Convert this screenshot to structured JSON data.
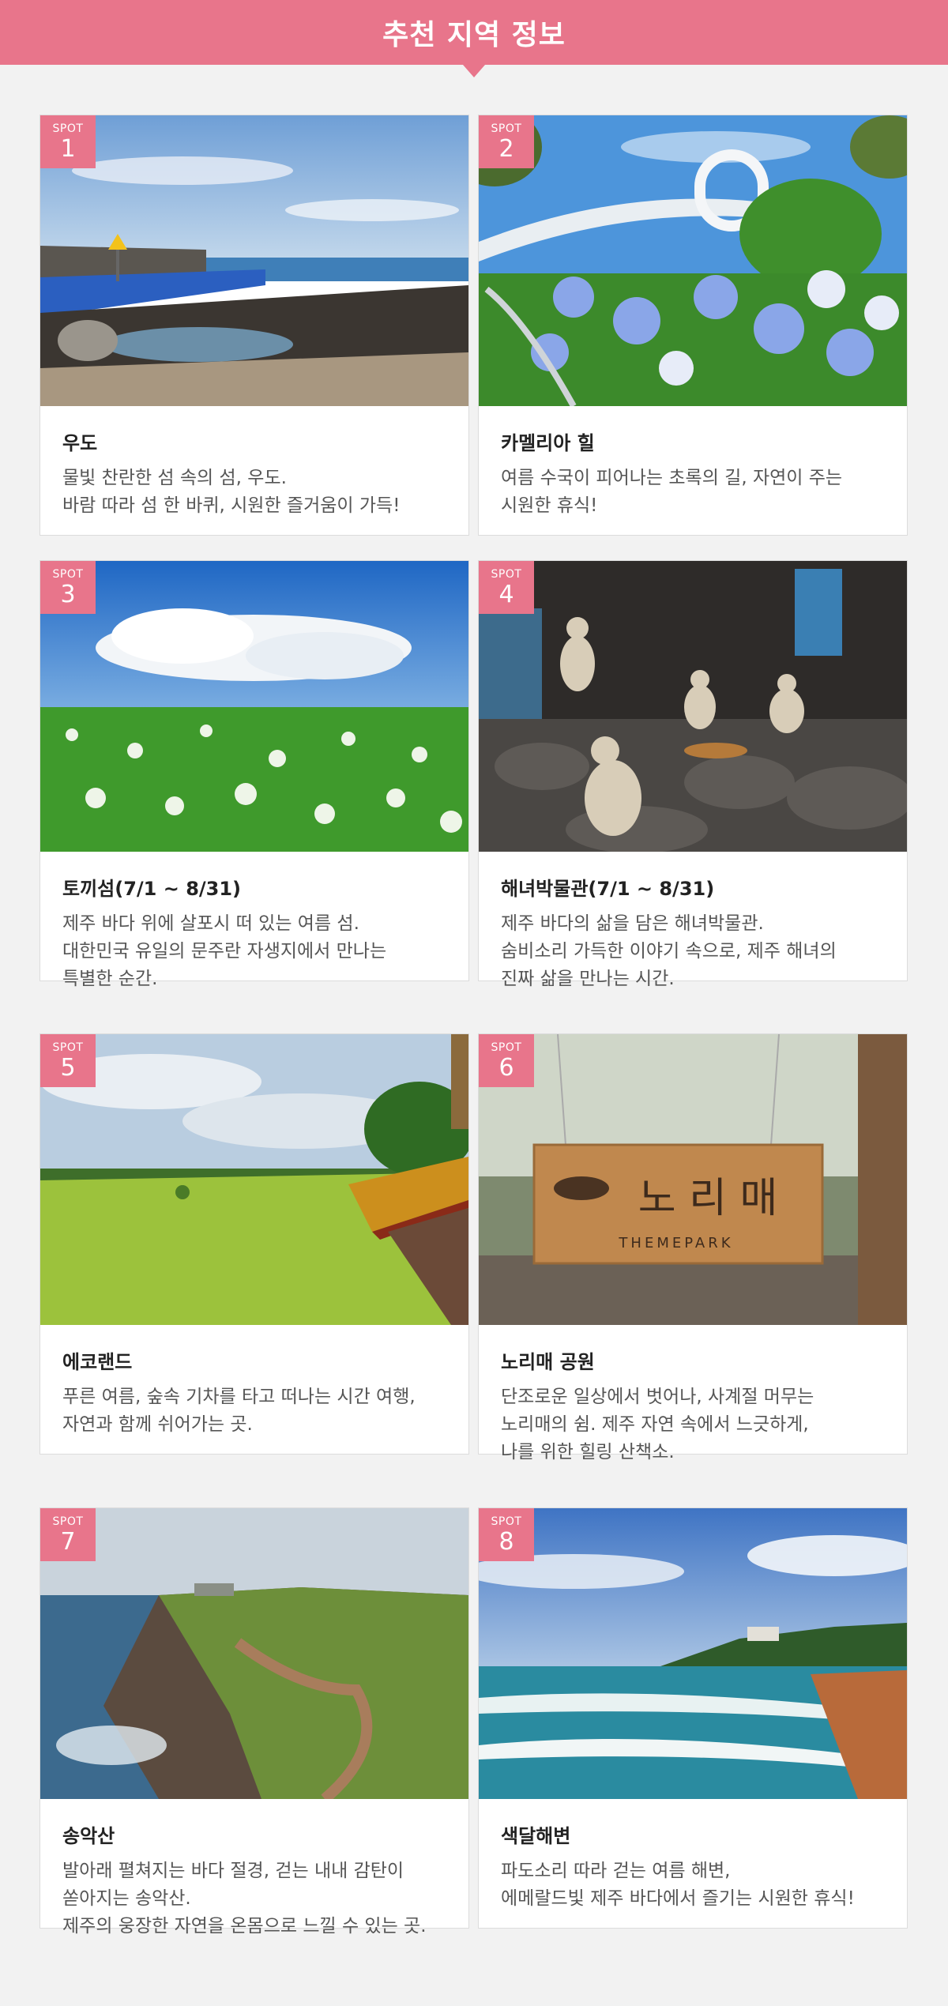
{
  "header": {
    "title": "추천 지역 정보"
  },
  "colors": {
    "accent": "#e8758b",
    "background": "#f2f2f2"
  },
  "spots": [
    {
      "badge_label": "SPOT",
      "number": "1",
      "title": "우도",
      "description": "물빛 찬란한 섬 속의 섬, 우도.\n바람 따라 섬 한 바퀴, 시원한 즐거움이 가득!",
      "image": "coastal-rocks-photo"
    },
    {
      "badge_label": "SPOT",
      "number": "2",
      "title": "카멜리아 힐",
      "description": "여름 수국이 피어나는 초록의 길, 자연이 주는\n시원한 휴식!",
      "image": "hydrangea-bridge-photo"
    },
    {
      "badge_label": "SPOT",
      "number": "3",
      "title": "토끼섬(7/1 ~ 8/31)",
      "description": "제주 바다 위에 살포시 떠 있는 여름 섬.\n대한민국 유일의 문주란 자생지에서 만나는\n특별한 순간.",
      "image": "lily-field-photo"
    },
    {
      "badge_label": "SPOT",
      "number": "4",
      "title": "해녀박물관(7/1 ~ 8/31)",
      "description": "제주 바다의 삶을 담은 해녀박물관.\n숨비소리 가득한 이야기 속으로, 제주 해녀의\n진짜 삶을 만나는 시간.",
      "image": "haenyeo-museum-photo"
    },
    {
      "badge_label": "SPOT",
      "number": "5",
      "title": "에코랜드",
      "description": "푸른 여름, 숲속 기차를 타고 떠나는 시간 여행,\n자연과 함께 쉬어가는 곳.",
      "image": "forest-train-photo"
    },
    {
      "badge_label": "SPOT",
      "number": "6",
      "title": "노리매 공원",
      "description": "단조로운 일상에서 벗어나, 사계절 머무는\n노리매의 쉼. 제주 자연 속에서 느긋하게,\n나를 위한 힐링 산책소.",
      "image": "norimae-sign-photo",
      "sign_text": "노 리 매",
      "sign_subtext": "THEMEPARK"
    },
    {
      "badge_label": "SPOT",
      "number": "7",
      "title": "송악산",
      "description": "발아래 펼쳐지는 바다 절경, 걷는 내내 감탄이\n쏟아지는 송악산.\n제주의 웅장한 자연을 온몸으로 느낄 수 있는 곳.",
      "image": "cliff-trail-photo"
    },
    {
      "badge_label": "SPOT",
      "number": "8",
      "title": "색달해변",
      "description": "파도소리 따라 걷는 여름 해변,\n에메랄드빛 제주 바다에서 즐기는 시원한 휴식!",
      "image": "beach-waves-photo"
    }
  ]
}
